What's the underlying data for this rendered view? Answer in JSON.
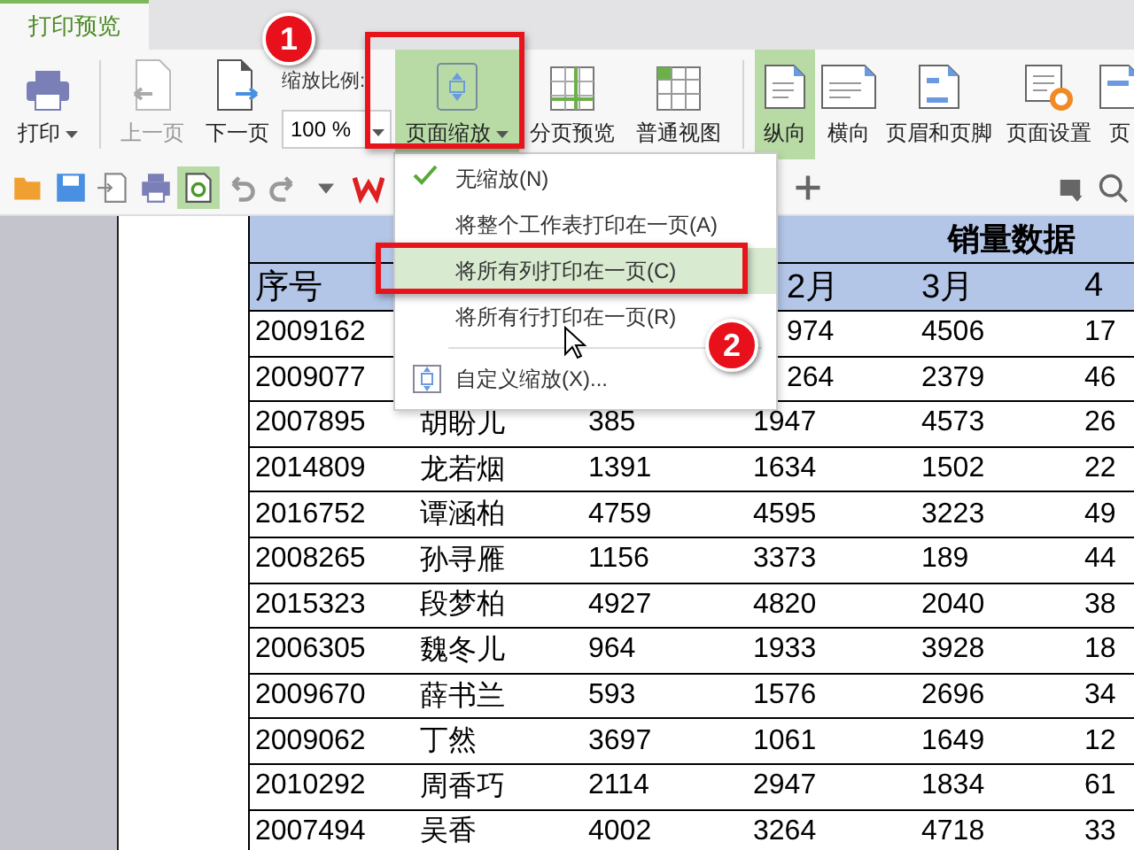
{
  "tabs": [
    {
      "label": "打印预览",
      "selected": true
    }
  ],
  "ribbon": {
    "buttons": [
      {
        "label": "打印",
        "caret": true,
        "disabled": false,
        "selected": false
      },
      {
        "label": "上一页",
        "caret": false,
        "disabled": true,
        "selected": false
      },
      {
        "label": "下一页",
        "caret": false,
        "disabled": false,
        "selected": false
      }
    ],
    "zoom": {
      "label": "缩放比例:",
      "value": "100 %"
    },
    "buttons2": [
      {
        "label": "页面缩放",
        "caret": true,
        "disabled": false,
        "selected": true
      },
      {
        "label": "分页预览",
        "caret": false,
        "disabled": false,
        "selected": false
      },
      {
        "label": "普通视图",
        "caret": false,
        "disabled": false,
        "selected": false
      }
    ],
    "buttons3": [
      {
        "label": "纵向",
        "caret": false,
        "disabled": false,
        "selected": true
      },
      {
        "label": "横向",
        "caret": false,
        "disabled": false,
        "selected": false
      },
      {
        "label": "页眉和页脚",
        "caret": false,
        "disabled": false,
        "selected": false
      },
      {
        "label": "页面设置",
        "caret": false,
        "disabled": false,
        "selected": false
      },
      {
        "label": "页",
        "caret": false,
        "disabled": false,
        "selected": false
      }
    ]
  },
  "menu": {
    "items": [
      {
        "kind": "check",
        "label": "无缩放(N)",
        "checked": true,
        "highlighted": false
      },
      {
        "kind": "item",
        "label": "将整个工作表打印在一页(A)",
        "highlighted": false
      },
      {
        "kind": "item",
        "label": "将所有列打印在一页(C)",
        "highlighted": true
      },
      {
        "kind": "item",
        "label": "将所有行打印在一页(R)",
        "highlighted": false
      },
      {
        "kind": "separator"
      },
      {
        "kind": "icon",
        "label": "自定义缩放(X)...",
        "highlighted": false
      }
    ]
  },
  "callouts": [
    "1",
    "2"
  ],
  "sheet": {
    "title": "销量数据",
    "header": {
      "col_1": "序号",
      "col_4": "2月",
      "col_5": "3月",
      "col_6": "4"
    },
    "rows": [
      {
        "col_1": "2009162",
        "col_4": "974",
        "col_5": "4506",
        "col_6": "17"
      },
      {
        "col_1": "2009077",
        "col_4": "264",
        "col_5": "2379",
        "col_6": "46"
      },
      [
        "2007895",
        "胡盼儿",
        "385",
        "1947",
        "4573",
        "26"
      ],
      [
        "2014809",
        "龙若烟",
        "1391",
        "1634",
        "1502",
        "22"
      ],
      [
        "2016752",
        "谭涵柏",
        "4759",
        "4595",
        "3223",
        "49"
      ],
      [
        "2008265",
        "孙寻雁",
        "1156",
        "3373",
        "189",
        "44"
      ],
      [
        "2015323",
        "段梦柏",
        "4927",
        "4820",
        "2040",
        "38"
      ],
      [
        "2006305",
        "魏冬儿",
        "964",
        "1933",
        "3928",
        "18"
      ],
      [
        "2009670",
        "薛书兰",
        "593",
        "1576",
        "2696",
        "34"
      ],
      [
        "2009062",
        "丁然",
        "3697",
        "1061",
        "1649",
        "12"
      ],
      [
        "2010292",
        "周香巧",
        "2114",
        "2947",
        "1834",
        "61"
      ],
      [
        "2007494",
        "吴香",
        "4002",
        "3264",
        "4718",
        "33"
      ]
    ]
  }
}
